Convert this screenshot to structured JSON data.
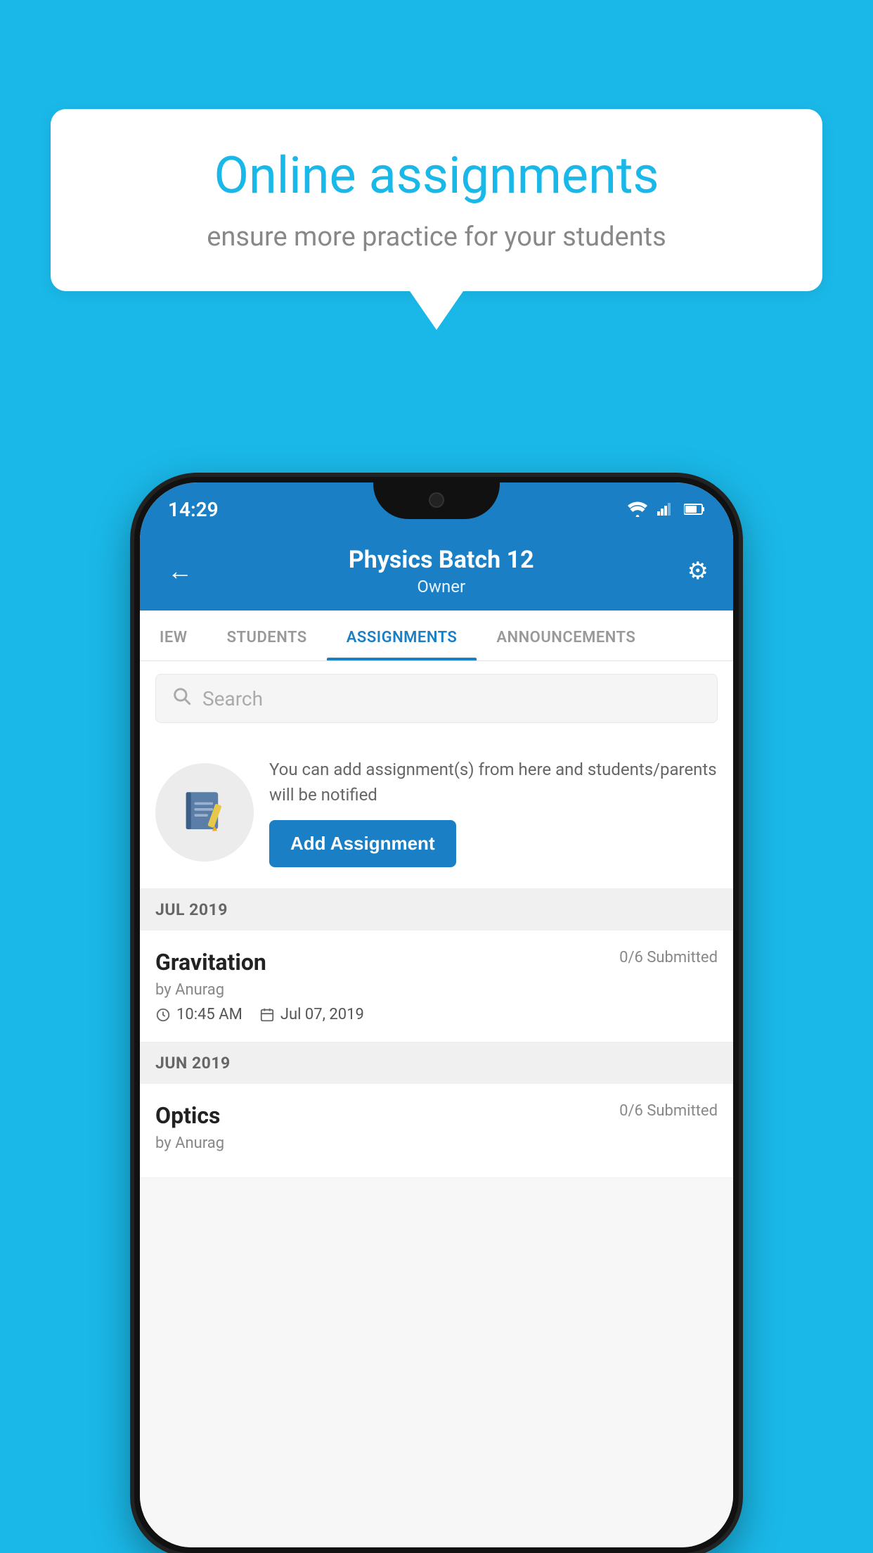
{
  "background_color": "#1ab8e8",
  "speech_bubble": {
    "title": "Online assignments",
    "subtitle": "ensure more practice for your students"
  },
  "status_bar": {
    "time": "14:29"
  },
  "header": {
    "title": "Physics Batch 12",
    "subtitle": "Owner",
    "back_label": "←",
    "gear_label": "⚙"
  },
  "tabs": [
    {
      "label": "IEW",
      "active": false
    },
    {
      "label": "STUDENTS",
      "active": false
    },
    {
      "label": "ASSIGNMENTS",
      "active": true
    },
    {
      "label": "ANNOUNCEMENTS",
      "active": false
    }
  ],
  "search": {
    "placeholder": "Search"
  },
  "promo": {
    "description": "You can add assignment(s) from here and students/parents will be notified",
    "button_label": "Add Assignment"
  },
  "assignment_sections": [
    {
      "label": "JUL 2019",
      "items": [
        {
          "name": "Gravitation",
          "submitted": "0/6 Submitted",
          "by": "by Anurag",
          "time": "10:45 AM",
          "date": "Jul 07, 2019"
        }
      ]
    },
    {
      "label": "JUN 2019",
      "items": [
        {
          "name": "Optics",
          "submitted": "0/6 Submitted",
          "by": "by Anurag",
          "time": "",
          "date": ""
        }
      ]
    }
  ]
}
